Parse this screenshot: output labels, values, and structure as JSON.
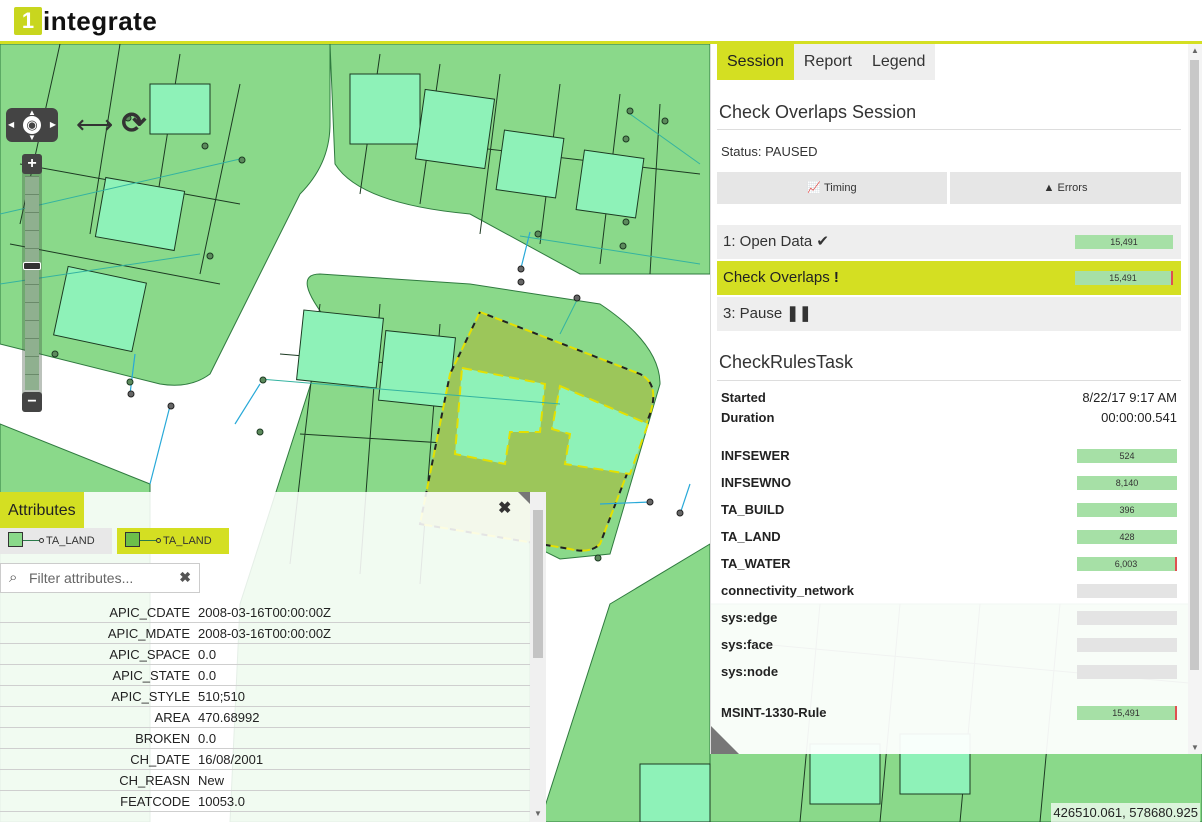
{
  "app": {
    "logo_mark": "1",
    "logo_word": "integrate"
  },
  "map": {
    "controls": {
      "pan_icon": "globe-icon",
      "extent_icon": "horizontal-arrows-icon",
      "refresh_icon": "refresh-icon",
      "zoom_in": "+",
      "zoom_out": "−"
    },
    "coordinates": "426510.061, 578680.925"
  },
  "panel": {
    "tabs": [
      {
        "label": "Session",
        "active": true
      },
      {
        "label": "Report",
        "active": false
      },
      {
        "label": "Legend",
        "active": false
      }
    ],
    "session_title": "Check Overlaps Session",
    "status": "Status: PAUSED",
    "timing_label": "Timing",
    "errors_label": "Errors",
    "steps": [
      {
        "label": "1: Open Data",
        "icon": "check-icon",
        "count": "15,491"
      },
      {
        "label": "Check Overlaps",
        "icon": "exclamation-icon",
        "count": "15,491"
      },
      {
        "label": "3: Pause",
        "icon": "pause-icon",
        "count": ""
      }
    ],
    "task_title": "CheckRulesTask",
    "started_label": "Started",
    "started_value": "8/22/17 9:17 AM",
    "duration_label": "Duration",
    "duration_value": "00:00:00.541",
    "features": [
      {
        "name": "INFSEWER",
        "count": "524"
      },
      {
        "name": "INFSEWNO",
        "count": "8,140"
      },
      {
        "name": "TA_BUILD",
        "count": "396"
      },
      {
        "name": "TA_LAND",
        "count": "428"
      },
      {
        "name": "TA_WATER",
        "count": "6,003"
      },
      {
        "name": "connectivity_network",
        "count": ""
      },
      {
        "name": "sys:edge",
        "count": ""
      },
      {
        "name": "sys:face",
        "count": ""
      },
      {
        "name": "sys:node",
        "count": ""
      }
    ],
    "rule": {
      "name": "MSINT-1330-Rule",
      "count": "15,491"
    }
  },
  "attributes": {
    "title": "Attributes",
    "layer_tabs": [
      "TA_LAND",
      "TA_LAND"
    ],
    "filter_placeholder": "Filter attributes...",
    "rows": [
      {
        "name": "APIC_CDATE",
        "value": "2008-03-16T00:00:00Z"
      },
      {
        "name": "APIC_MDATE",
        "value": "2008-03-16T00:00:00Z"
      },
      {
        "name": "APIC_SPACE",
        "value": "0.0"
      },
      {
        "name": "APIC_STATE",
        "value": "0.0"
      },
      {
        "name": "APIC_STYLE",
        "value": "510;510"
      },
      {
        "name": "AREA",
        "value": "470.68992"
      },
      {
        "name": "BROKEN",
        "value": "0.0"
      },
      {
        "name": "CH_DATE",
        "value": "16/08/2001"
      },
      {
        "name": "CH_REASN",
        "value": "New"
      },
      {
        "name": "FEATCODE",
        "value": "10053.0"
      }
    ]
  },
  "colors": {
    "accent": "#d4df22",
    "land": "#8ad98a",
    "building": "#8ef2b8",
    "road": "#ffffff",
    "selection": "#9cc65a"
  }
}
